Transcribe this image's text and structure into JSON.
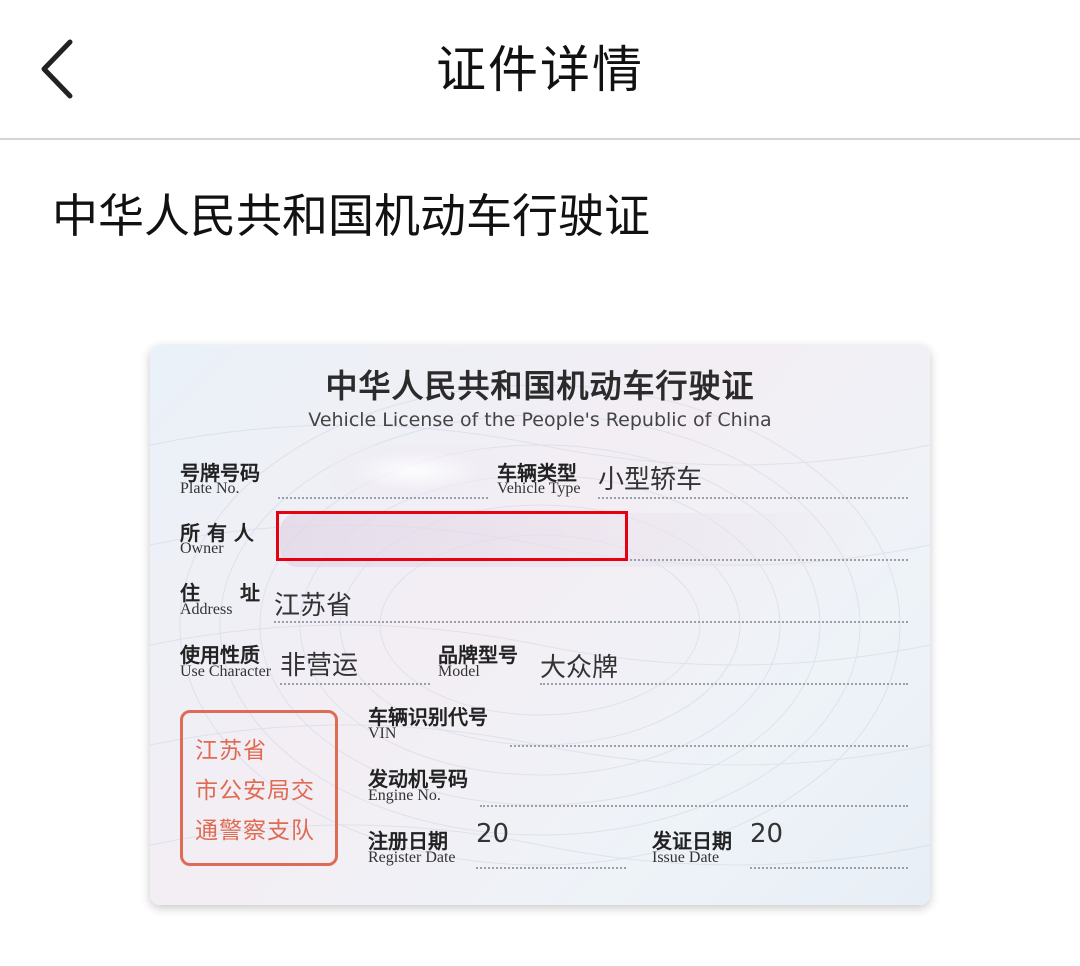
{
  "header": {
    "title": "证件详情",
    "back_icon": "chevron-left-icon"
  },
  "section": {
    "title": "中华人民共和国机动车行驶证"
  },
  "license_card": {
    "title_zh": "中华人民共和国机动车行驶证",
    "title_en": "Vehicle License of the People's Republic of China",
    "fields": {
      "plate_no": {
        "label_zh": "号牌号码",
        "label_en": "Plate No.",
        "value": ""
      },
      "vehicle_type": {
        "label_zh": "车辆类型",
        "label_en": "Vehicle Type",
        "value": "小型轿车"
      },
      "owner": {
        "label_zh": "所 有 人",
        "label_en": "Owner",
        "value": ""
      },
      "address": {
        "label_zh": "住　　址",
        "label_en": "Address",
        "value": "江苏省"
      },
      "use_character": {
        "label_zh": "使用性质",
        "label_en": "Use Character",
        "value": "非营运"
      },
      "model": {
        "label_zh": "品牌型号",
        "label_en": "Model",
        "value": "大众牌"
      },
      "vin": {
        "label_zh": "车辆识别代号",
        "label_en": "VIN",
        "value": ""
      },
      "engine_no": {
        "label_zh": "发动机号码",
        "label_en": "Engine No.",
        "value": ""
      },
      "register_date": {
        "label_zh": "注册日期",
        "label_en": "Register Date",
        "value": "20"
      },
      "issue_date": {
        "label_zh": "发证日期",
        "label_en": "Issue Date",
        "value": "20"
      }
    },
    "seal_lines": [
      "江苏省",
      "市公安局交",
      "通警察支队"
    ],
    "highlight_color": "#e60012",
    "seal_color": "#dd6b55"
  }
}
